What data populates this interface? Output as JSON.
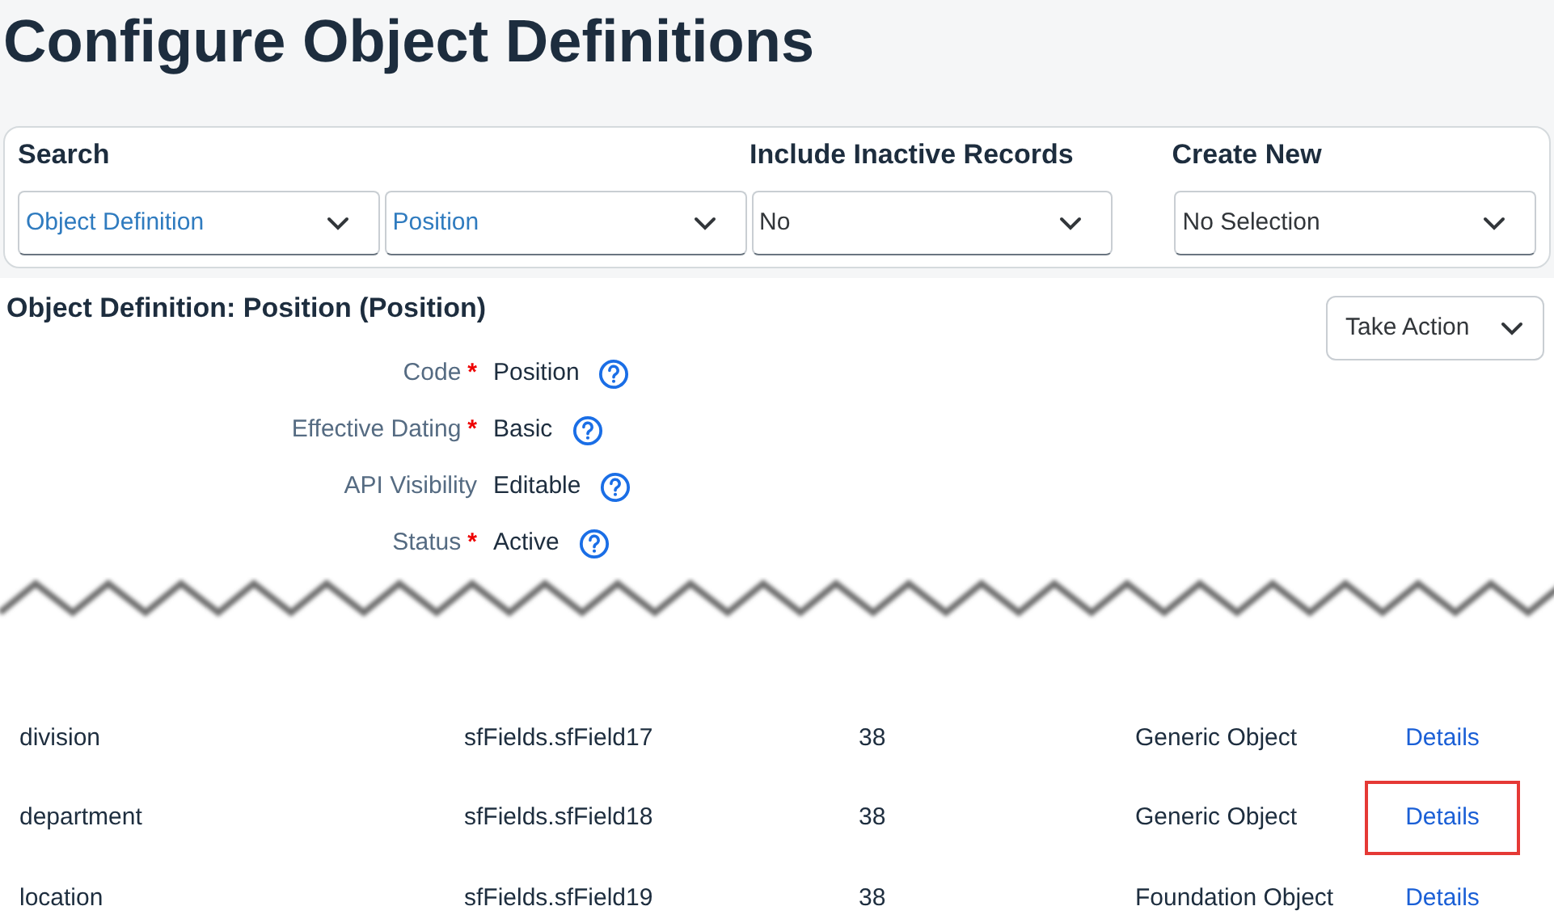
{
  "page_title": "Configure Object Definitions",
  "search_panel": {
    "headings": [
      {
        "label": "Search"
      },
      {
        "label": "Include Inactive Records"
      },
      {
        "label": "Create New"
      }
    ],
    "dropdowns": [
      {
        "value": "Object Definition",
        "kind": "link"
      },
      {
        "value": "Position",
        "kind": "link"
      },
      {
        "value": "No",
        "kind": "plain"
      },
      {
        "value": "No Selection",
        "kind": "plain"
      }
    ]
  },
  "detail": {
    "title": "Object Definition: Position (Position)",
    "action_button": "Take Action",
    "required_symbol": "*",
    "fields": [
      {
        "label": "Code",
        "required": true,
        "value": "Position"
      },
      {
        "label": "Effective Dating",
        "required": true,
        "value": "Basic"
      },
      {
        "label": "API Visibility",
        "required": false,
        "value": "Editable"
      },
      {
        "label": "Status",
        "required": true,
        "value": "Active"
      }
    ]
  },
  "table": {
    "rows": [
      {
        "cells": [
          "division",
          "sfFields.sfField17",
          "38",
          "Generic Object"
        ],
        "link": "Details",
        "highlighted": false
      },
      {
        "cells": [
          "department",
          "sfFields.sfField18",
          "38",
          "Generic Object"
        ],
        "link": "Details",
        "highlighted": true
      },
      {
        "cells": [
          "location",
          "sfFields.sfField19",
          "38",
          "Foundation Object"
        ],
        "link": "Details",
        "highlighted": false
      }
    ]
  }
}
